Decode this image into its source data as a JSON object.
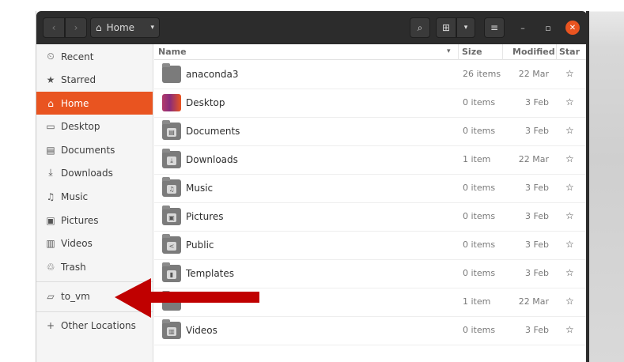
{
  "header": {
    "nav_back": "‹",
    "nav_forward": "›",
    "location_icon": "⌂",
    "location_label": "Home",
    "location_caret": "▾",
    "search_icon": "⌕",
    "grid_icon": "⊞",
    "view_caret": "▾",
    "menu_icon": "≡",
    "minimize_icon": "–",
    "maximize_icon": "▫",
    "close_icon": "✕"
  },
  "sidebar": {
    "items": [
      {
        "label": "Recent",
        "icon": "clock-icon",
        "glyph": "⏲"
      },
      {
        "label": "Starred",
        "icon": "star-icon",
        "glyph": "★"
      },
      {
        "label": "Home",
        "icon": "home-icon",
        "glyph": "⌂"
      },
      {
        "label": "Desktop",
        "icon": "desktop-icon",
        "glyph": "▭"
      },
      {
        "label": "Documents",
        "icon": "document-icon",
        "glyph": "▤"
      },
      {
        "label": "Downloads",
        "icon": "download-icon",
        "glyph": "⤓"
      },
      {
        "label": "Music",
        "icon": "music-icon",
        "glyph": "♫"
      },
      {
        "label": "Pictures",
        "icon": "picture-icon",
        "glyph": "▣"
      },
      {
        "label": "Videos",
        "icon": "video-icon",
        "glyph": "▥"
      },
      {
        "label": "Trash",
        "icon": "trash-icon",
        "glyph": "♲"
      },
      {
        "label": "to_vm",
        "icon": "folder-icon",
        "glyph": "▱"
      },
      {
        "label": "Other Locations",
        "icon": "plus-icon",
        "glyph": "+"
      }
    ]
  },
  "columns": {
    "name": "Name",
    "sort_icon": "▾",
    "size": "Size",
    "modified": "Modified",
    "star": "Star"
  },
  "files": [
    {
      "name": "anaconda3",
      "size": "26 items",
      "modified": "22 Mar",
      "emblem": ""
    },
    {
      "name": "Desktop",
      "size": "0 items",
      "modified": "3 Feb",
      "emblem": ""
    },
    {
      "name": "Documents",
      "size": "0 items",
      "modified": "3 Feb",
      "emblem": "▤"
    },
    {
      "name": "Downloads",
      "size": "1 item",
      "modified": "22 Mar",
      "emblem": "⤓"
    },
    {
      "name": "Music",
      "size": "0 items",
      "modified": "3 Feb",
      "emblem": "♫"
    },
    {
      "name": "Pictures",
      "size": "0 items",
      "modified": "3 Feb",
      "emblem": "▣"
    },
    {
      "name": "Public",
      "size": "0 items",
      "modified": "3 Feb",
      "emblem": "<"
    },
    {
      "name": "Templates",
      "size": "0 items",
      "modified": "3 Feb",
      "emblem": "▮"
    },
    {
      "name": "",
      "size": "1 item",
      "modified": "22 Mar",
      "emblem": ""
    },
    {
      "name": "Videos",
      "size": "0 items",
      "modified": "3 Feb",
      "emblem": "▥"
    }
  ],
  "star_glyph": "☆",
  "colors": {
    "accent": "#e95420",
    "headerbar": "#2c2c2c",
    "arrow": "#c00000"
  }
}
